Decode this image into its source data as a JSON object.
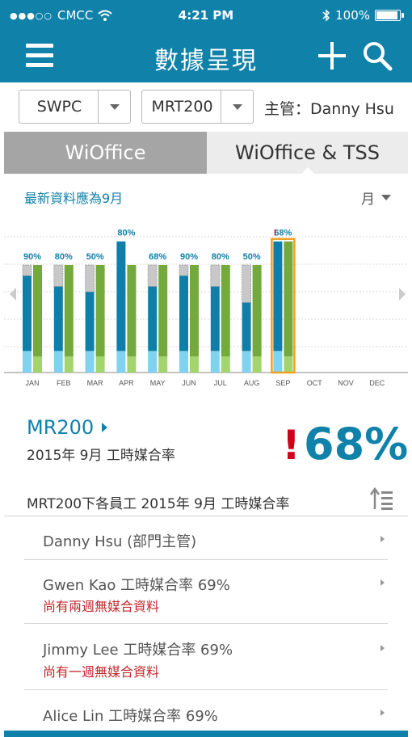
{
  "status_bar": {
    "signal": "●●●○○",
    "carrier": "CMCC",
    "time": "4:21 PM",
    "battery": "100%",
    "battery_level": 1.0,
    "icons": [
      "wifi-icon",
      "bluetooth-icon",
      "battery-icon"
    ]
  },
  "nav": {
    "title": "數據呈現",
    "icons": [
      "menu-icon",
      "plus-icon",
      "search-icon"
    ]
  },
  "filters": {
    "company": "SWPC",
    "department": "MRT200",
    "manager_label": "主管：Danny Hsu"
  },
  "tabs": [
    {
      "label": "WiOffice",
      "active": true
    },
    {
      "label": "WiOffice & TSS",
      "active": false
    }
  ],
  "info_text": "最新資料應為9月",
  "period_select": "月",
  "colors": {
    "brand": "#1081a9",
    "blue": "#0f7ea8",
    "green": "#73a93d",
    "light_blue": "#7fd3f0",
    "light_green": "#a3d46e",
    "gray": "#c8c8c8",
    "alert": "#d0021b",
    "highlight": "#f0a023"
  },
  "chart_data": {
    "type": "bar",
    "categories": [
      "JAN",
      "FEB",
      "MAR",
      "APR",
      "MAY",
      "JUN",
      "JUL",
      "AUG",
      "SEP",
      "OCT",
      "NOV",
      "DEC"
    ],
    "rate_labels": [
      "90%",
      "80%",
      "50%",
      "80%",
      "68%",
      "90%",
      "80%",
      "50%",
      "68%",
      "",
      "",
      ""
    ],
    "bars": [
      {
        "left_total": 100,
        "left_gray": 10,
        "left_lower": 20,
        "right_total": 100,
        "right_lower": 15
      },
      {
        "left_total": 100,
        "left_gray": 20,
        "left_lower": 20,
        "right_total": 100,
        "right_lower": 15
      },
      {
        "left_total": 100,
        "left_gray": 25,
        "left_lower": 20,
        "right_total": 100,
        "right_lower": 15
      },
      {
        "left_total": 122,
        "left_gray": 0,
        "left_lower": 20,
        "right_total": 100,
        "right_lower": 15
      },
      {
        "left_total": 100,
        "left_gray": 20,
        "left_lower": 20,
        "right_total": 100,
        "right_lower": 15
      },
      {
        "left_total": 100,
        "left_gray": 10,
        "left_lower": 20,
        "right_total": 100,
        "right_lower": 15
      },
      {
        "left_total": 100,
        "left_gray": 20,
        "left_lower": 20,
        "right_total": 100,
        "right_lower": 15
      },
      {
        "left_total": 100,
        "left_gray": 35,
        "left_lower": 20,
        "right_total": 100,
        "right_lower": 15
      },
      {
        "left_total": 122,
        "left_gray": 0,
        "left_lower": 20,
        "right_total": 122,
        "right_lower": 15
      },
      null,
      null,
      null
    ],
    "selected_month": "SEP",
    "alert_month": "SEP",
    "alert_mark": "!",
    "grid": true
  },
  "summary": {
    "name": "MR200",
    "subtitle": "2015年 9月 工時媒合率",
    "alert": "!",
    "value": "68%"
  },
  "list": {
    "header": "MRT200下各員工  2015年 9月 工時媒合率",
    "items": [
      {
        "name": "Danny Hsu  (部門主管)",
        "warning": ""
      },
      {
        "name": "Gwen Kao 工時媒合率 69%",
        "warning": "尚有兩週無媒合資料"
      },
      {
        "name": "Jimmy Lee  工時媒合率 69%",
        "warning": "尚有一週無媒合資料"
      },
      {
        "name": "Alice Lin 工時媒合率 69%",
        "warning": ""
      }
    ]
  }
}
